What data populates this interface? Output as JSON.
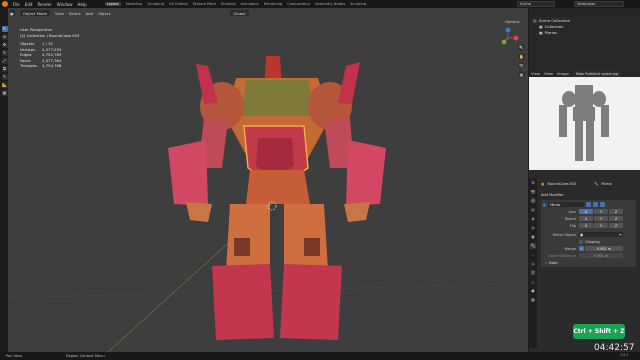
{
  "menu": {
    "items": [
      "File",
      "Edit",
      "Render",
      "Window",
      "Help"
    ],
    "workspaces": [
      "Layout",
      "Modeling",
      "Sculpting",
      "UV Editing",
      "Texture Paint",
      "Shading",
      "Animation",
      "Rendering",
      "Compositing",
      "Geometry Nodes",
      "Scripting"
    ],
    "active_workspace": "Layout",
    "scene": "Scene",
    "view_layer": "ViewLayer"
  },
  "viewport": {
    "mode": "Object Mode",
    "menus": [
      "View",
      "Select",
      "Add",
      "Object"
    ],
    "orientation": "Global",
    "options": "Options",
    "perspective": "User Perspective",
    "collection": "(2) Collection | RoundCube.003",
    "stats": [
      {
        "label": "Objects",
        "value": "1 / 35"
      },
      {
        "label": "Vertices",
        "value": "2,377,535"
      },
      {
        "label": "Edges",
        "value": "4,754,783"
      },
      {
        "label": "Faces",
        "value": "2,377,384"
      },
      {
        "label": "Triangles",
        "value": "4,754,768"
      }
    ]
  },
  "outliner": {
    "root": "Scene Collection",
    "items": [
      "Collection",
      "Planes"
    ]
  },
  "image_editor": {
    "menus": [
      "View",
      "View",
      "Image"
    ],
    "image_name": "Robo Portfolio4 square.jpg"
  },
  "properties": {
    "object_name": "RoundCube.003",
    "modifier_tab": "Mirror",
    "add_modifier": "Add Modifier",
    "modifier_name": "Mirror",
    "axis_label": "Axis",
    "bisect_label": "Bisect",
    "flip_label": "Flip",
    "axes": [
      "X",
      "Y",
      "Z"
    ],
    "mirror_object_label": "Mirror Object",
    "clipping_label": "Clipping",
    "merge_label": "Merge",
    "merge_value": "0.001 m",
    "bisect_distance_label": "Bisect Distance",
    "bisect_distance_value": "0.001 m",
    "data_label": "Data"
  },
  "status": {
    "items": [
      "Pan View",
      "Region Context Menu"
    ],
    "version": "3.6.1"
  },
  "overlay": {
    "shortcut": "Ctrl + Shift + Z",
    "clock": "04:42:57"
  },
  "colors": {
    "accent": "#4772b3",
    "brand": "#e87d0d",
    "shortcut_bg": "#1aa454"
  }
}
